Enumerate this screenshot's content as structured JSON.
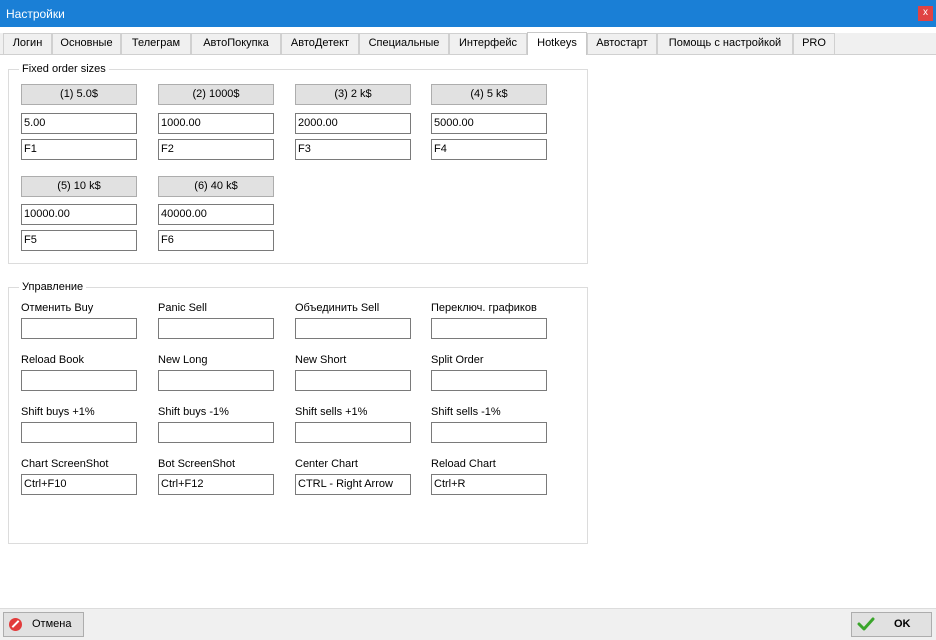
{
  "window": {
    "title": "Настройки",
    "close_label": "x"
  },
  "tabs": [
    {
      "label": "Логин"
    },
    {
      "label": "Основные"
    },
    {
      "label": "Телеграм"
    },
    {
      "label": "АвтоПокупка"
    },
    {
      "label": "АвтоДетект"
    },
    {
      "label": "Специальные"
    },
    {
      "label": "Интерфейс"
    },
    {
      "label": "Hotkeys"
    },
    {
      "label": "Автостарт"
    },
    {
      "label": "Помощь с настройкой"
    },
    {
      "label": "PRO"
    }
  ],
  "active_tab": "Hotkeys",
  "fixed_orders": {
    "legend": "Fixed order sizes",
    "items": [
      {
        "button": "(1)  5.0$",
        "amount": "5.00",
        "hotkey": "F1"
      },
      {
        "button": "(2)  1000$",
        "amount": "1000.00",
        "hotkey": "F2"
      },
      {
        "button": "(3)  2 k$",
        "amount": "2000.00",
        "hotkey": "F3"
      },
      {
        "button": "(4)  5 k$",
        "amount": "5000.00",
        "hotkey": "F4"
      },
      {
        "button": "(5)  10 k$",
        "amount": "10000.00",
        "hotkey": "F5"
      },
      {
        "button": "(6)  40 k$",
        "amount": "40000.00",
        "hotkey": "F6"
      }
    ]
  },
  "control": {
    "legend": "Управление",
    "items": [
      {
        "label": "Отменить Buy",
        "value": ""
      },
      {
        "label": "Panic Sell",
        "value": ""
      },
      {
        "label": "Объединить Sell",
        "value": ""
      },
      {
        "label": "Переключ. графиков",
        "value": ""
      },
      {
        "label": "Reload Book",
        "value": ""
      },
      {
        "label": "New Long",
        "value": ""
      },
      {
        "label": "New Short",
        "value": ""
      },
      {
        "label": "Split Order",
        "value": ""
      },
      {
        "label": "Shift buys +1%",
        "value": ""
      },
      {
        "label": "Shift buys -1%",
        "value": ""
      },
      {
        "label": "Shift sells +1%",
        "value": ""
      },
      {
        "label": "Shift sells -1%",
        "value": ""
      },
      {
        "label": "Chart ScreenShot",
        "value": "Ctrl+F10"
      },
      {
        "label": "Bot ScreenShot",
        "value": "Ctrl+F12"
      },
      {
        "label": "Center Chart",
        "value": "CTRL - Right Arrow"
      },
      {
        "label": "Reload Chart",
        "value": "Ctrl+R"
      }
    ]
  },
  "footer": {
    "cancel_label": "Отмена",
    "ok_label": "OK"
  },
  "colors": {
    "titlebar": "#1a7fd6",
    "close": "#e04343",
    "ok_check": "#3aa52b",
    "cancel_icon": "#e23b3b"
  }
}
